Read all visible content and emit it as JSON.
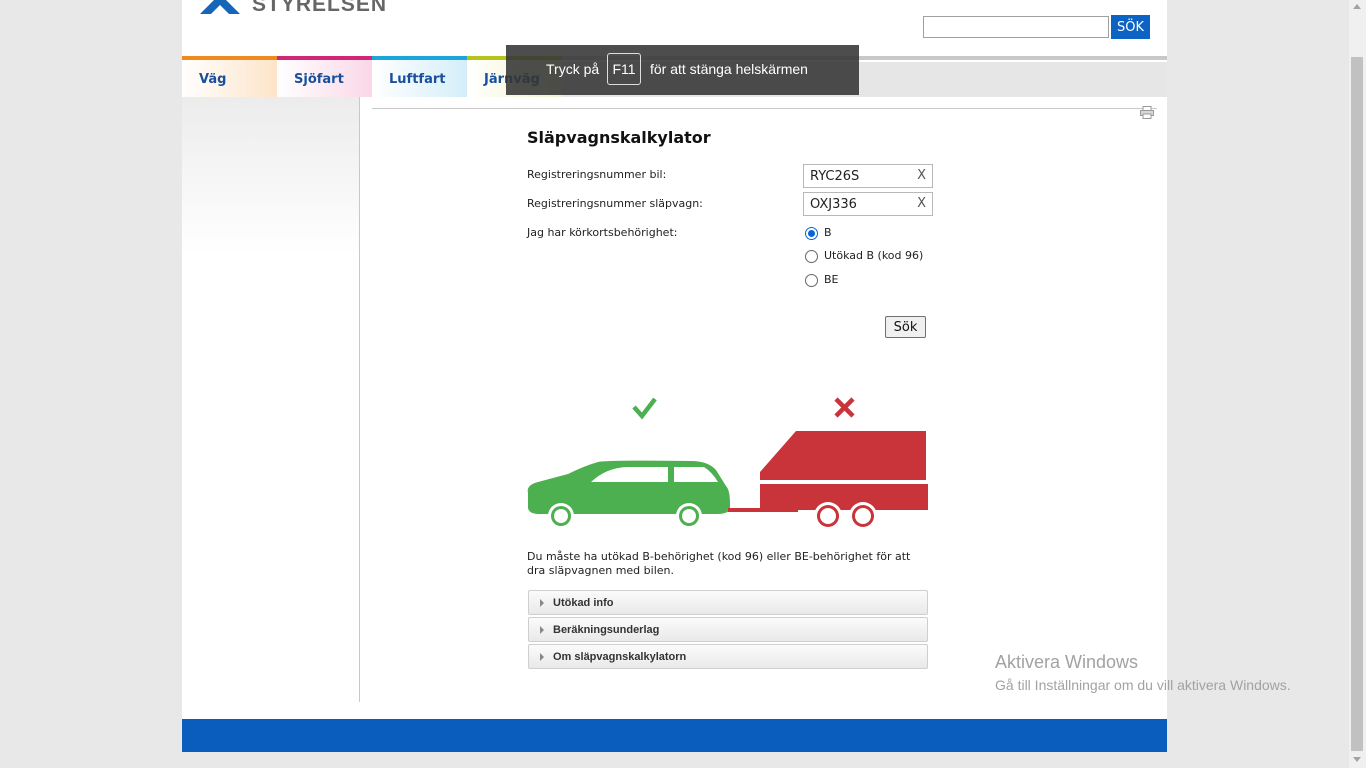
{
  "header": {
    "logo_text": "STYRELSEN",
    "search_placeholder": "",
    "search_button": "SÖK"
  },
  "nav": {
    "tabs": [
      {
        "label": "Väg",
        "color": "#ee8a1e"
      },
      {
        "label": "Sjöfart",
        "color": "#d0267a"
      },
      {
        "label": "Luftfart",
        "color": "#1aa6d8"
      },
      {
        "label": "Järnväg",
        "color": "#b5c41a"
      }
    ]
  },
  "fullscreen_notice": {
    "before": "Tryck på",
    "key": "F11",
    "after": "för att stänga helskärmen"
  },
  "calculator": {
    "title": "Släpvagnskalkylator",
    "car_label": "Registreringsnummer bil:",
    "car_value": "RYC26S",
    "trailer_label": "Registreringsnummer släpvagn:",
    "trailer_value": "OXJ336",
    "clear_symbol": "X",
    "license_label": "Jag har körkortsbehörighet:",
    "license_options": [
      {
        "label": "B",
        "checked": true
      },
      {
        "label": "Utökad B (kod 96)",
        "checked": false
      },
      {
        "label": "BE",
        "checked": false
      }
    ],
    "submit_label": "Sök",
    "illustration": {
      "car_color": "#4caf50",
      "trailer_color": "#c8343a",
      "car_status": "check-icon",
      "trailer_status": "cross-icon"
    },
    "result_text": "Du måste ha utökad B-behörighet (kod 96) eller BE-behörighet för att dra släpvagnen med bilen.",
    "accordions": [
      {
        "label": "Utökad info"
      },
      {
        "label": "Beräkningsunderlag"
      },
      {
        "label": "Om släpvagnskalkylatorn"
      }
    ]
  },
  "colors": {
    "brand_blue": "#0a5dbd",
    "button_blue": "#0d63c4"
  },
  "windows_watermark": {
    "title": "Aktivera Windows",
    "subtitle": "Gå till Inställningar om du vill aktivera Windows."
  }
}
